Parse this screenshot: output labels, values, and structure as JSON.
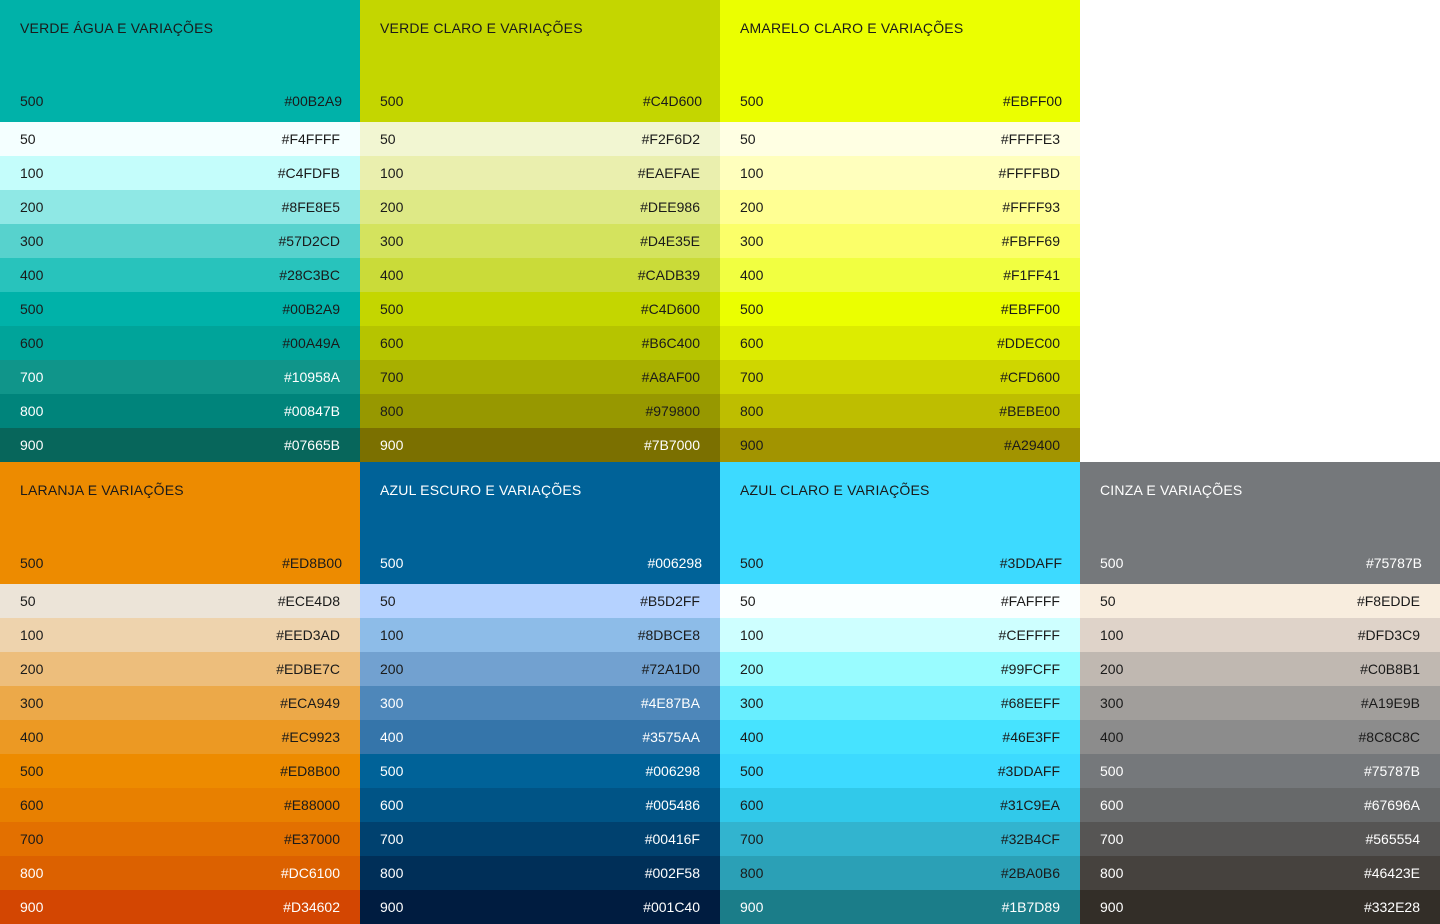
{
  "palettes": [
    {
      "title": "VERDE ÁGUA E VARIAÇÕES",
      "base": {
        "shade": "500",
        "hex": "#00B2A9"
      },
      "color": "#00B2A9",
      "text_color": "#1a1a1a",
      "shades": [
        {
          "shade": "50",
          "hex": "#F4FFFF",
          "color": "#F4FFFF",
          "text": "#1a1a1a"
        },
        {
          "shade": "100",
          "hex": "#C4FDFB",
          "color": "#C4FDFB",
          "text": "#1a1a1a"
        },
        {
          "shade": "200",
          "hex": "#8FE8E5",
          "color": "#8FE8E5",
          "text": "#1a1a1a"
        },
        {
          "shade": "300",
          "hex": "#57D2CD",
          "color": "#57D2CD",
          "text": "#1a1a1a"
        },
        {
          "shade": "400",
          "hex": "#28C3BC",
          "color": "#28C3BC",
          "text": "#1a1a1a"
        },
        {
          "shade": "500",
          "hex": "#00B2A9",
          "color": "#00B2A9",
          "text": "#1a1a1a"
        },
        {
          "shade": "600",
          "hex": "#00A49A",
          "color": "#00A49A",
          "text": "#1a1a1a"
        },
        {
          "shade": "700",
          "hex": "#10958A",
          "color": "#10958A",
          "text": "#ffffff"
        },
        {
          "shade": "800",
          "hex": "#00847B",
          "color": "#00847B",
          "text": "#ffffff"
        },
        {
          "shade": "900",
          "hex": "#07665B",
          "color": "#07665B",
          "text": "#ffffff"
        }
      ]
    },
    {
      "title": "VERDE CLARO E VARIAÇÕES",
      "base": {
        "shade": "500",
        "hex": "#C4D600"
      },
      "color": "#C4D600",
      "text_color": "#1a1a1a",
      "shades": [
        {
          "shade": "50",
          "hex": "#F2F6D2",
          "color": "#F2F6D2",
          "text": "#1a1a1a"
        },
        {
          "shade": "100",
          "hex": "#EAEFAE",
          "color": "#EAEFAE",
          "text": "#1a1a1a"
        },
        {
          "shade": "200",
          "hex": "#DEE986",
          "color": "#DEE986",
          "text": "#1a1a1a"
        },
        {
          "shade": "300",
          "hex": "#D4E35E",
          "color": "#D4E35E",
          "text": "#1a1a1a"
        },
        {
          "shade": "400",
          "hex": "#CADB39",
          "color": "#CADB39",
          "text": "#1a1a1a"
        },
        {
          "shade": "500",
          "hex": "#C4D600",
          "color": "#C4D600",
          "text": "#1a1a1a"
        },
        {
          "shade": "600",
          "hex": "#B6C400",
          "color": "#B6C400",
          "text": "#1a1a1a"
        },
        {
          "shade": "700",
          "hex": "#A8AF00",
          "color": "#A8AF00",
          "text": "#1a1a1a"
        },
        {
          "shade": "800",
          "hex": "#979800",
          "color": "#979800",
          "text": "#1a1a1a"
        },
        {
          "shade": "900",
          "hex": "#7B7000",
          "color": "#7B7000",
          "text": "#ffffff"
        }
      ]
    },
    {
      "title": "AMARELO CLARO E VARIAÇÕES",
      "base": {
        "shade": "500",
        "hex": "#EBFF00"
      },
      "color": "#EBFF00",
      "text_color": "#1a1a1a",
      "shades": [
        {
          "shade": "50",
          "hex": "#FFFFE3",
          "color": "#FFFFE3",
          "text": "#1a1a1a"
        },
        {
          "shade": "100",
          "hex": "#FFFFBD",
          "color": "#FFFFBD",
          "text": "#1a1a1a"
        },
        {
          "shade": "200",
          "hex": "#FFFF93",
          "color": "#FFFF93",
          "text": "#1a1a1a"
        },
        {
          "shade": "300",
          "hex": "#FBFF69",
          "color": "#FBFF69",
          "text": "#1a1a1a"
        },
        {
          "shade": "400",
          "hex": "#F1FF41",
          "color": "#F1FF41",
          "text": "#1a1a1a"
        },
        {
          "shade": "500",
          "hex": "#EBFF00",
          "color": "#EBFF00",
          "text": "#1a1a1a"
        },
        {
          "shade": "600",
          "hex": "#DDEC00",
          "color": "#DDEC00",
          "text": "#1a1a1a"
        },
        {
          "shade": "700",
          "hex": "#CFD600",
          "color": "#CFD600",
          "text": "#1a1a1a"
        },
        {
          "shade": "800",
          "hex": "#BEBE00",
          "color": "#BEBE00",
          "text": "#1a1a1a"
        },
        {
          "shade": "900",
          "hex": "#A29400",
          "color": "#A29400",
          "text": "#1a1a1a"
        }
      ]
    },
    null,
    {
      "title": "LARANJA E VARIAÇÕES",
      "base": {
        "shade": "500",
        "hex": "#ED8B00"
      },
      "color": "#ED8B00",
      "text_color": "#1a1a1a",
      "shades": [
        {
          "shade": "50",
          "hex": "#ECE4D8",
          "color": "#ECE4D8",
          "text": "#1a1a1a"
        },
        {
          "shade": "100",
          "hex": "#EED3AD",
          "color": "#EED3AD",
          "text": "#1a1a1a"
        },
        {
          "shade": "200",
          "hex": "#EDBE7C",
          "color": "#EDBE7C",
          "text": "#1a1a1a"
        },
        {
          "shade": "300",
          "hex": "#ECA949",
          "color": "#ECA949",
          "text": "#1a1a1a"
        },
        {
          "shade": "400",
          "hex": "#EC9923",
          "color": "#EC9923",
          "text": "#1a1a1a"
        },
        {
          "shade": "500",
          "hex": "#ED8B00",
          "color": "#ED8B00",
          "text": "#1a1a1a"
        },
        {
          "shade": "600",
          "hex": "#E88000",
          "color": "#E88000",
          "text": "#1a1a1a"
        },
        {
          "shade": "700",
          "hex": "#E37000",
          "color": "#E37000",
          "text": "#1a1a1a"
        },
        {
          "shade": "800",
          "hex": "#DC6100",
          "color": "#DC6100",
          "text": "#ffffff"
        },
        {
          "shade": "900",
          "hex": "#D34602",
          "color": "#D34602",
          "text": "#ffffff"
        }
      ]
    },
    {
      "title": "AZUL ESCURO E VARIAÇÕES",
      "base": {
        "shade": "500",
        "hex": "#006298"
      },
      "color": "#006298",
      "text_color": "#ffffff",
      "shades": [
        {
          "shade": "50",
          "hex": "#B5D2FF",
          "color": "#B5D2FF",
          "text": "#1a1a1a"
        },
        {
          "shade": "100",
          "hex": "#8DBCE8",
          "color": "#8DBCE8",
          "text": "#1a1a1a"
        },
        {
          "shade": "200",
          "hex": "#72A1D0",
          "color": "#72A1D0",
          "text": "#1a1a1a"
        },
        {
          "shade": "300",
          "hex": "#4E87BA",
          "color": "#4E87BA",
          "text": "#ffffff"
        },
        {
          "shade": "400",
          "hex": "#3575AA",
          "color": "#3575AA",
          "text": "#ffffff"
        },
        {
          "shade": "500",
          "hex": "#006298",
          "color": "#006298",
          "text": "#ffffff"
        },
        {
          "shade": "600",
          "hex": "#005486",
          "color": "#005486",
          "text": "#ffffff"
        },
        {
          "shade": "700",
          "hex": "#00416F",
          "color": "#00416F",
          "text": "#ffffff"
        },
        {
          "shade": "800",
          "hex": "#002F58",
          "color": "#002F58",
          "text": "#ffffff"
        },
        {
          "shade": "900",
          "hex": "#001C40",
          "color": "#001C40",
          "text": "#ffffff"
        }
      ]
    },
    {
      "title": "AZUL CLARO E VARIAÇÕES",
      "base": {
        "shade": "500",
        "hex": "#3DDAFF"
      },
      "color": "#3DDAFF",
      "text_color": "#1a1a1a",
      "shades": [
        {
          "shade": "50",
          "hex": "#FAFFFF",
          "color": "#FAFFFF",
          "text": "#1a1a1a"
        },
        {
          "shade": "100",
          "hex": "#CEFFFF",
          "color": "#CEFFFF",
          "text": "#1a1a1a"
        },
        {
          "shade": "200",
          "hex": "#99FCFF",
          "color": "#99FCFF",
          "text": "#1a1a1a"
        },
        {
          "shade": "300",
          "hex": "#68EEFF",
          "color": "#68EEFF",
          "text": "#1a1a1a"
        },
        {
          "shade": "400",
          "hex": "#46E3FF",
          "color": "#46E3FF",
          "text": "#1a1a1a"
        },
        {
          "shade": "500",
          "hex": "#3DDAFF",
          "color": "#3DDAFF",
          "text": "#1a1a1a"
        },
        {
          "shade": "600",
          "hex": "#31C9EA",
          "color": "#31C9EA",
          "text": "#1a1a1a"
        },
        {
          "shade": "700",
          "hex": "#32B4CF",
          "color": "#32B4CF",
          "text": "#1a1a1a"
        },
        {
          "shade": "800",
          "hex": "#2BA0B6",
          "color": "#2BA0B6",
          "text": "#1a1a1a"
        },
        {
          "shade": "900",
          "hex": "#1B7D89",
          "color": "#1B7D89",
          "text": "#ffffff"
        }
      ]
    },
    {
      "title": "CINZA E VARIAÇÕES",
      "base": {
        "shade": "500",
        "hex": "#75787B"
      },
      "color": "#75787B",
      "text_color": "#ffffff",
      "shades": [
        {
          "shade": "50",
          "hex": "#F8EDDE",
          "color": "#F8EDDE",
          "text": "#1a1a1a"
        },
        {
          "shade": "100",
          "hex": "#DFD3C9",
          "color": "#DFD3C9",
          "text": "#1a1a1a"
        },
        {
          "shade": "200",
          "hex": "#C0B8B1",
          "color": "#C0B8B1",
          "text": "#1a1a1a"
        },
        {
          "shade": "300",
          "hex": "#A19E9B",
          "color": "#A19E9B",
          "text": "#1a1a1a"
        },
        {
          "shade": "400",
          "hex": "#8C8C8C",
          "color": "#8C8C8C",
          "text": "#1a1a1a"
        },
        {
          "shade": "500",
          "hex": "#75787B",
          "color": "#75787B",
          "text": "#ffffff"
        },
        {
          "shade": "600",
          "hex": "#67696A",
          "color": "#67696A",
          "text": "#ffffff"
        },
        {
          "shade": "700",
          "hex": "#565554",
          "color": "#565554",
          "text": "#ffffff"
        },
        {
          "shade": "800",
          "hex": "#46423E",
          "color": "#46423E",
          "text": "#ffffff"
        },
        {
          "shade": "900",
          "hex": "#332E28",
          "color": "#332E28",
          "text": "#ffffff"
        }
      ]
    }
  ]
}
